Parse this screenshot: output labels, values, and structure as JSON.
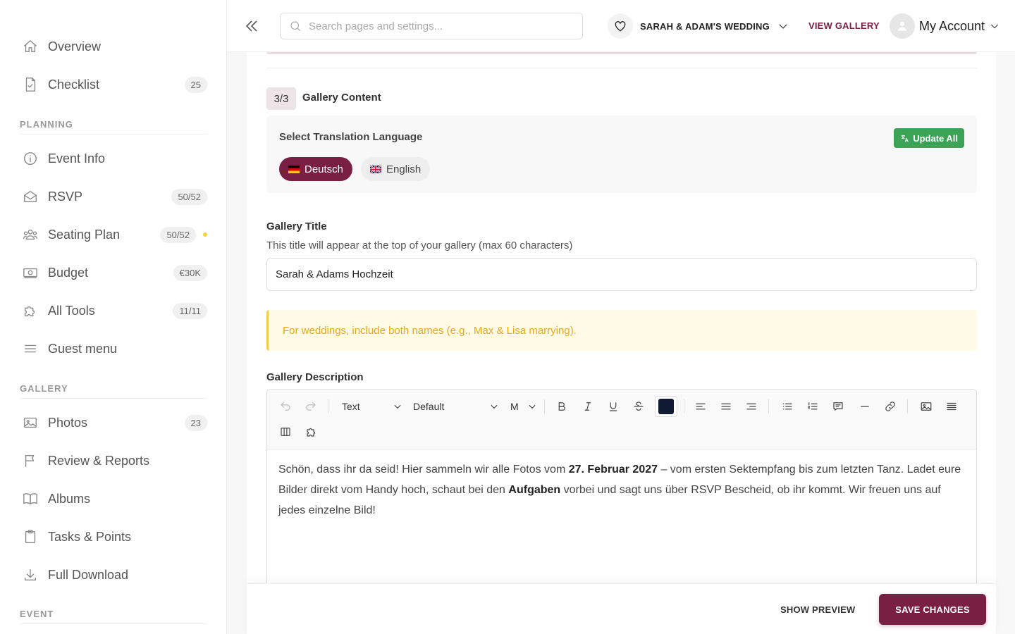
{
  "sidebar": {
    "top_items": [
      {
        "label": "Overview",
        "icon": "home-icon"
      },
      {
        "label": "Checklist",
        "icon": "checklist-icon",
        "badge": "25"
      }
    ],
    "sections": [
      {
        "label": "PLANNING",
        "items": [
          {
            "label": "Event Info",
            "icon": "info-icon"
          },
          {
            "label": "RSVP",
            "icon": "envelope-icon",
            "badge": "50/52"
          },
          {
            "label": "Seating Plan",
            "icon": "people-icon",
            "badge": "50/52",
            "status_dot": "#f4d63c"
          },
          {
            "label": "Budget",
            "icon": "money-icon",
            "badge": "€30K"
          },
          {
            "label": "All Tools",
            "icon": "puzzle-icon",
            "badge": "11/11"
          },
          {
            "label": "Guest menu",
            "icon": "menu-icon"
          }
        ]
      },
      {
        "label": "GALLERY",
        "items": [
          {
            "label": "Photos",
            "icon": "image-icon",
            "badge": "23"
          },
          {
            "label": "Review & Reports",
            "icon": "flag-icon"
          },
          {
            "label": "Albums",
            "icon": "book-icon"
          },
          {
            "label": "Tasks & Points",
            "icon": "clipboard-icon"
          },
          {
            "label": "Full Download",
            "icon": "download-icon"
          }
        ]
      },
      {
        "label": "EVENT",
        "items": []
      }
    ]
  },
  "topbar": {
    "search_placeholder": "Search pages and settings...",
    "wedding_name": "SARAH & ADAM'S WEDDING",
    "view_gallery": "VIEW GALLERY",
    "account_label": "My Account"
  },
  "content": {
    "step": "3/3",
    "step_title": "Gallery Content",
    "translation": {
      "label": "Select Translation Language",
      "update_all": "Update All",
      "languages": [
        {
          "label": "Deutsch",
          "active": true
        },
        {
          "label": "English",
          "active": false
        }
      ]
    },
    "gallery_title": {
      "label": "Gallery Title",
      "help": "This title will appear at the top of your gallery (max 60 characters)",
      "value": "Sarah & Adams Hochzeit"
    },
    "warning": "For weddings, include both names (e.g., Max & Lisa marrying).",
    "description": {
      "label": "Gallery Description",
      "toolbar": {
        "block_type": "Text",
        "font": "Default",
        "size": "M",
        "text_color": "#0f1b33"
      },
      "text": {
        "p1": "Schön, dass ihr da seid! Hier sammeln wir alle Fotos vom ",
        "b1": "27. Februar 2027",
        "p2": " – vom ersten Sektempfang bis zum letzten Tanz. Ladet eure Bilder direkt vom Handy hoch, schaut bei den ",
        "b2": "Aufgaben",
        "p3": " vorbei und sagt uns über RSVP Bescheid, ob ihr kommt. Wir freuen uns auf jedes einzelne Bild!"
      }
    }
  },
  "footer": {
    "show_preview": "SHOW PREVIEW",
    "save_changes": "SAVE CHANGES"
  },
  "colors": {
    "brand": "#7a1f44",
    "success": "#3aa355",
    "warning_text": "#e7a817"
  }
}
